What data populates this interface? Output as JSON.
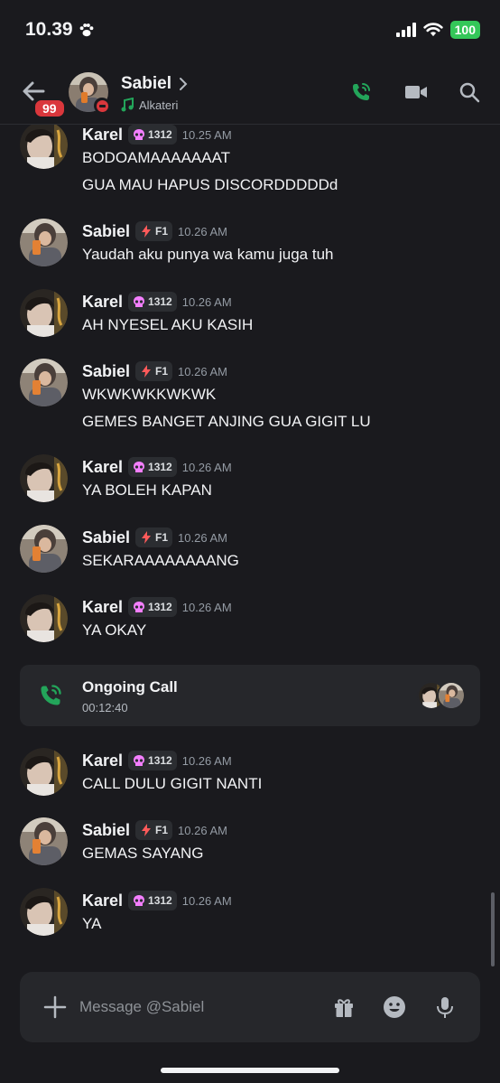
{
  "status_bar": {
    "time": "10.39",
    "battery": "100"
  },
  "header": {
    "name": "Sabiel",
    "badge": "99",
    "activity": "Alkateri"
  },
  "users": {
    "karel": {
      "name": "Karel",
      "tag": "1312"
    },
    "sabiel": {
      "name": "Sabiel",
      "tag": "F1"
    }
  },
  "messages": [
    {
      "user": "Karel",
      "tag": "1312",
      "time": "10.25 AM",
      "lines": [
        "BODOAMAAAAAAAT",
        "GUA MAU HAPUS DISCORDDDDDd"
      ]
    },
    {
      "user": "Sabiel",
      "tag": "F1",
      "time": "10.26 AM",
      "lines": [
        "Yaudah aku punya wa kamu juga tuh"
      ]
    },
    {
      "user": "Karel",
      "tag": "1312",
      "time": "10.26 AM",
      "lines": [
        "AH NYESEL AKU KASIH"
      ]
    },
    {
      "user": "Sabiel",
      "tag": "F1",
      "time": "10.26 AM",
      "lines": [
        "WKWKWKKWKWK",
        "GEMES BANGET ANJING GUA GIGIT LU"
      ]
    },
    {
      "user": "Karel",
      "tag": "1312",
      "time": "10.26 AM",
      "lines": [
        "YA BOLEH KAPAN"
      ]
    },
    {
      "user": "Sabiel",
      "tag": "F1",
      "time": "10.26 AM",
      "lines": [
        "SEKARAAAAAAAANG"
      ]
    },
    {
      "user": "Karel",
      "tag": "1312",
      "time": "10.26 AM",
      "lines": [
        "YA OKAY"
      ]
    },
    {
      "user": "Karel",
      "tag": "1312",
      "time": "10.26 AM",
      "lines": [
        "CALL DULU GIGIT NANTI"
      ]
    },
    {
      "user": "Sabiel",
      "tag": "F1",
      "time": "10.26 AM",
      "lines": [
        "GEMAS SAYANG"
      ]
    },
    {
      "user": "Karel",
      "tag": "1312",
      "time": "10.26 AM",
      "lines": [
        "YA"
      ]
    }
  ],
  "call": {
    "title": "Ongoing Call",
    "duration": "00:12:40"
  },
  "composer": {
    "placeholder": "Message @Sabiel"
  },
  "colors": {
    "accent_green": "#23a55a",
    "danger": "#da373c",
    "background": "#1a1a1e"
  },
  "icons": [
    "back-arrow-icon",
    "phone-icon",
    "video-icon",
    "search-icon",
    "plus-icon",
    "gift-icon",
    "emoji-icon",
    "microphone-icon",
    "music-note-icon",
    "skull-icon",
    "lightning-icon"
  ]
}
